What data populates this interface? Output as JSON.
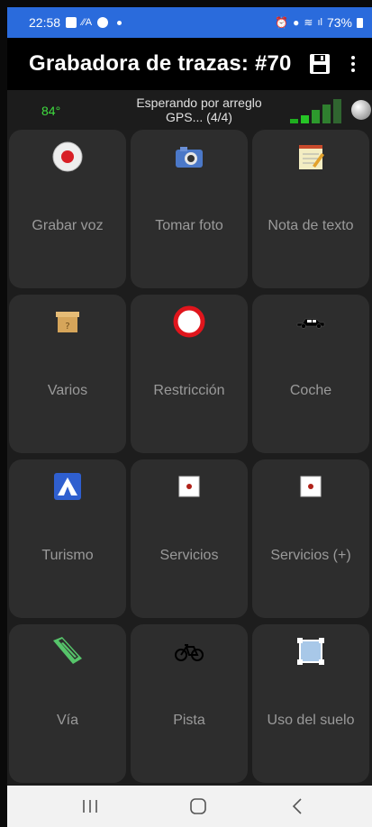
{
  "status_bar": {
    "time": "22:58",
    "battery": "73%"
  },
  "app_bar": {
    "title": "Grabadora de trazas: #70",
    "save_icon": "save-icon",
    "menu_icon": "more-vert-icon"
  },
  "gps": {
    "heading": "84°",
    "status_line1": "Esperando por arreglo",
    "status_line2": "GPS... (4/4)"
  },
  "tiles": [
    {
      "label": "Grabar voz",
      "icon": "record-icon"
    },
    {
      "label": "Tomar foto",
      "icon": "camera-icon"
    },
    {
      "label": "Nota de texto",
      "icon": "notepad-icon"
    },
    {
      "label": "Varios",
      "icon": "box-icon"
    },
    {
      "label": "Restricción",
      "icon": "restriction-icon"
    },
    {
      "label": "Coche",
      "icon": "car-icon"
    },
    {
      "label": "Turismo",
      "icon": "camping-icon"
    },
    {
      "label": "Servicios",
      "icon": "service-icon"
    },
    {
      "label": "Servicios (+)",
      "icon": "service-plus-icon"
    },
    {
      "label": "Vía",
      "icon": "road-icon"
    },
    {
      "label": "Pista",
      "icon": "bicycle-icon"
    },
    {
      "label": "Uso del suelo",
      "icon": "landuse-icon"
    }
  ],
  "colors": {
    "status_blue": "#2a6bdc",
    "gps_green": "#3fdc3f",
    "tile_bg": "#2d2d2d"
  }
}
